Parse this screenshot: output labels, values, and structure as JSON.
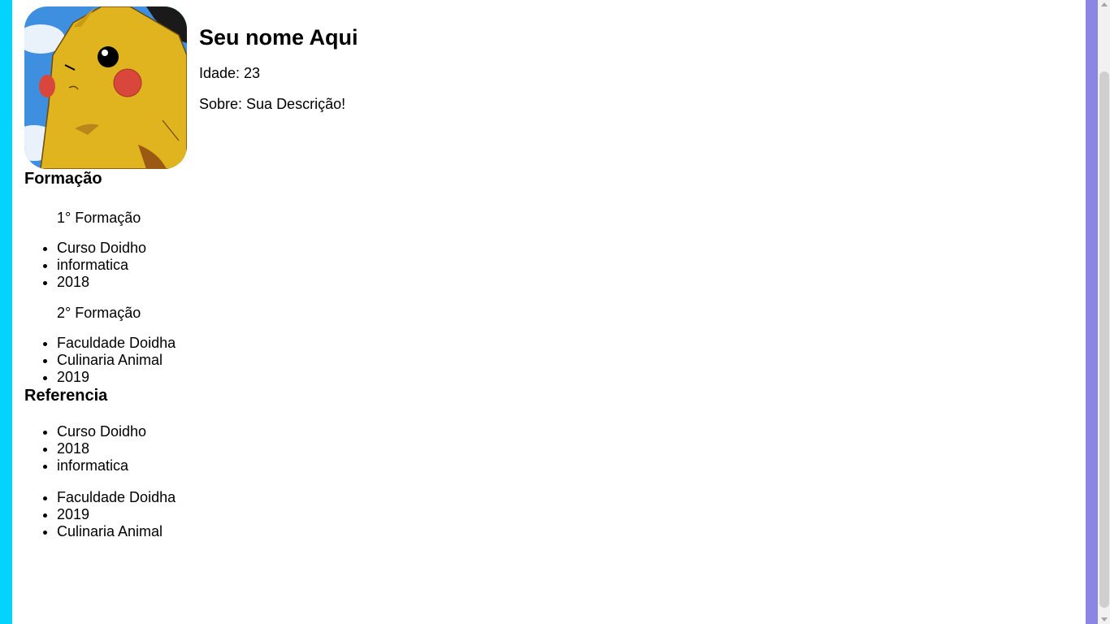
{
  "colors": {
    "left_stripe": "#00d4ff",
    "right_stripe": "#8b86e4",
    "background": "#ffffff"
  },
  "profile": {
    "avatar_alt": "pikachu-avatar",
    "name": "Seu nome Aqui",
    "age": "Idade: 23",
    "about": "Sobre: Sua Descrição!"
  },
  "formacao": {
    "title": "Formação",
    "groups": [
      {
        "heading": "1° Formação",
        "items": [
          "Curso Doidho",
          "informatica",
          "2018"
        ]
      },
      {
        "heading": "2° Formação",
        "items": [
          "Faculdade Doidha",
          "Culinaria Animal",
          "2019"
        ]
      }
    ]
  },
  "referencia": {
    "title": "Referencia",
    "groups": [
      {
        "items": [
          "Curso Doidho",
          "2018",
          "informatica"
        ]
      },
      {
        "items": [
          "Faculdade Doidha",
          "2019",
          "Culinaria Animal"
        ]
      }
    ]
  }
}
